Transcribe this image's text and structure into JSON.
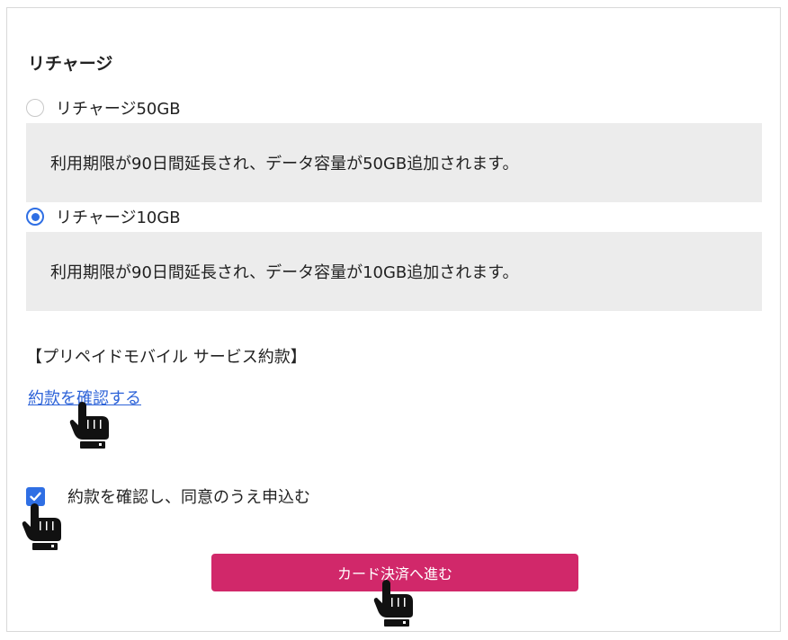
{
  "recharge": {
    "title": "リチャージ",
    "options": [
      {
        "label": "リチャージ50GB",
        "description": "利用期限が90日間延長され、データ容量が50GB追加されます。",
        "selected": false
      },
      {
        "label": "リチャージ10GB",
        "description": "利用期限が90日間延長され、データ容量が10GB追加されます。",
        "selected": true
      }
    ]
  },
  "terms": {
    "heading": "【プリペイドモバイル サービス約款】",
    "link_label": "約款を確認する",
    "agree_label": "約款を確認し、同意のうえ申込む",
    "agree_checked": true
  },
  "payment": {
    "button_label": "カード決済へ進む",
    "button_color": "#d1286a"
  },
  "colors": {
    "accent_blue": "#2f6fe4",
    "link_blue": "#2d63d8",
    "desc_bg": "#ececec"
  },
  "icons": [
    "pointing-hand-icon",
    "radio-icon",
    "checkmark-icon"
  ]
}
